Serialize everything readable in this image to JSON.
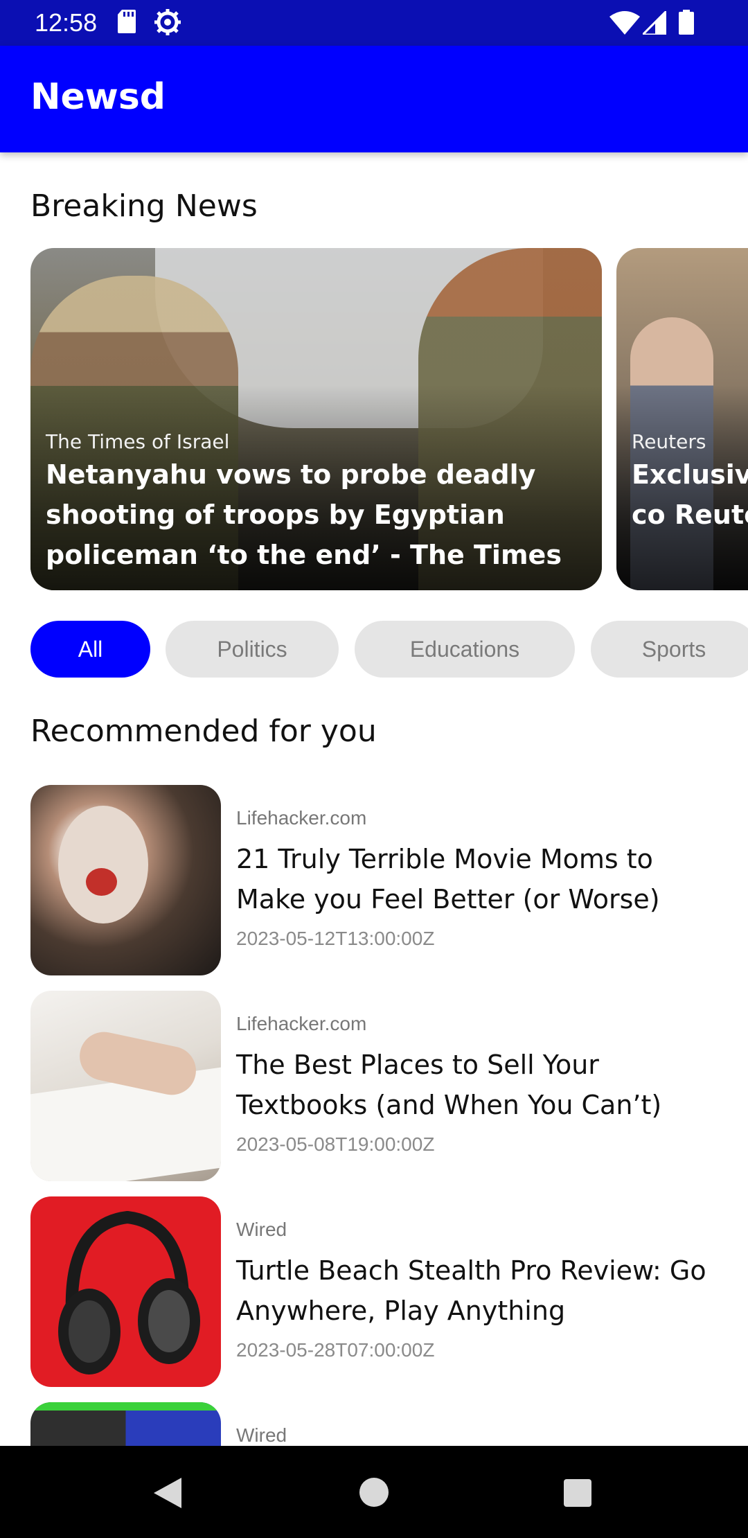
{
  "status_bar": {
    "time": "12:58",
    "icons": [
      "sd-card-icon",
      "gear-icon",
      "wifi-icon",
      "signal-icon",
      "battery-icon"
    ]
  },
  "app_bar": {
    "title": "Newsd"
  },
  "breaking": {
    "title": "Breaking News",
    "cards": [
      {
        "source": "The Times of Israel",
        "title": "Netanyahu vows to probe deadly shooting of troops by Egyptian policeman ‘to the end’ - The Times of"
      },
      {
        "source": "Reuters",
        "title": "Exclusive secret co Reuters.c"
      }
    ]
  },
  "categories": {
    "active": "All",
    "items": [
      "All",
      "Politics",
      "Educations",
      "Sports"
    ]
  },
  "recommended": {
    "title": "Recommended for you",
    "items": [
      {
        "source": "Lifehacker.com",
        "title": "21 Truly Terrible Movie Moms to Make you Feel Better (or Worse)",
        "date": "2023-05-12T13:00:00Z"
      },
      {
        "source": "Lifehacker.com",
        "title": "The Best Places to Sell Your Textbooks (and When You Can’t)",
        "date": "2023-05-08T19:00:00Z"
      },
      {
        "source": "Wired",
        "title": "Turtle Beach Stealth Pro Review: Go Anywhere, Play Anything",
        "date": "2023-05-28T07:00:00Z"
      },
      {
        "source": "Wired",
        "title": "",
        "date": ""
      }
    ]
  },
  "colors": {
    "status_bar": "#0b0fb3",
    "primary": "#0000ff",
    "chip_inactive": "#e5e5e5",
    "nav_bar": "#000000"
  }
}
